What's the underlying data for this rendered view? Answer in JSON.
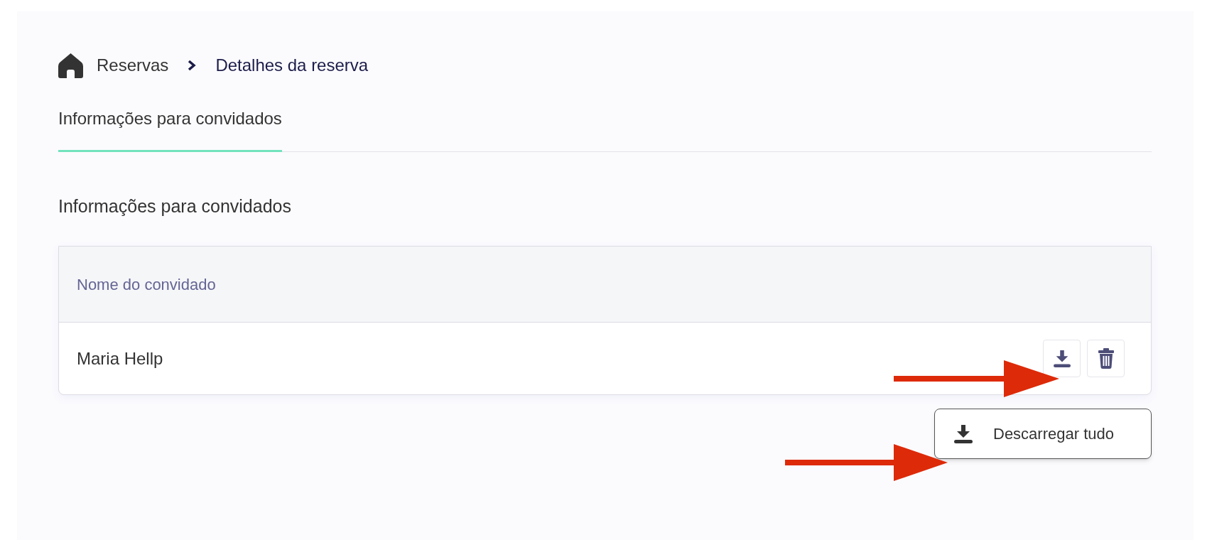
{
  "breadcrumb": [
    {
      "label": "Reservas",
      "current": false
    },
    {
      "label": "Detalhes da reserva",
      "current": true
    }
  ],
  "tabs": [
    {
      "label": "Informações para convidados",
      "selected": true
    }
  ],
  "section_title": "Informações para convidados",
  "table": {
    "columns": [
      "Nome do convidado"
    ],
    "rows": [
      {
        "name": "Maria Hellp"
      }
    ]
  },
  "download_all_button": "Descarregar tudo"
}
